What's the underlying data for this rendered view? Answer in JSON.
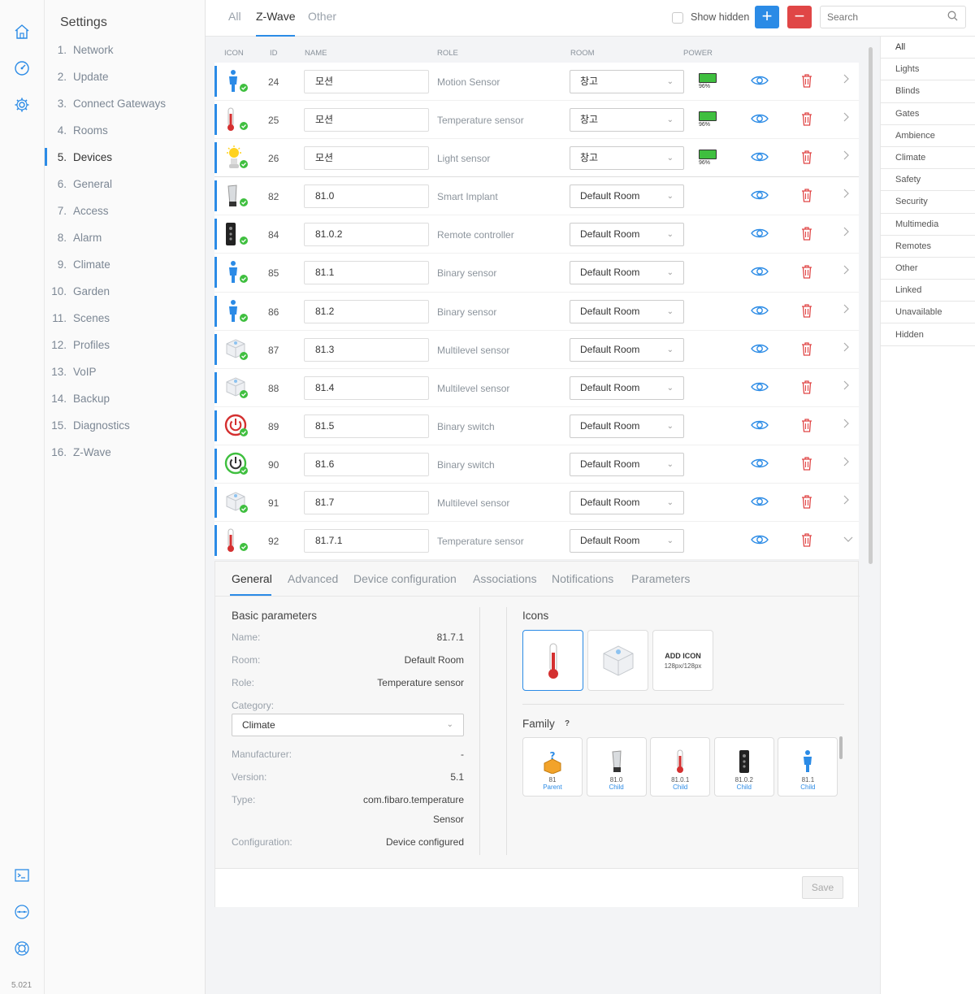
{
  "version": "5.021",
  "settings": {
    "title": "Settings",
    "items": [
      {
        "num": "1.",
        "label": "Network"
      },
      {
        "num": "2.",
        "label": "Update"
      },
      {
        "num": "3.",
        "label": "Connect Gateways"
      },
      {
        "num": "4.",
        "label": "Rooms"
      },
      {
        "num": "5.",
        "label": "Devices"
      },
      {
        "num": "6.",
        "label": "General"
      },
      {
        "num": "7.",
        "label": "Access"
      },
      {
        "num": "8.",
        "label": "Alarm"
      },
      {
        "num": "9.",
        "label": "Climate"
      },
      {
        "num": "10.",
        "label": "Garden"
      },
      {
        "num": "11.",
        "label": "Scenes"
      },
      {
        "num": "12.",
        "label": "Profiles"
      },
      {
        "num": "13.",
        "label": "VoIP"
      },
      {
        "num": "14.",
        "label": "Backup"
      },
      {
        "num": "15.",
        "label": "Diagnostics"
      },
      {
        "num": "16.",
        "label": "Z-Wave"
      }
    ]
  },
  "topbar": {
    "tabs": [
      "All",
      "Z-Wave",
      "Other"
    ],
    "show_hidden": "Show hidden",
    "add": "+",
    "remove": "−",
    "search_placeholder": "Search"
  },
  "filters": [
    "All",
    "Lights",
    "Blinds",
    "Gates",
    "Ambience",
    "Climate",
    "Safety",
    "Security",
    "Multimedia",
    "Remotes",
    "Other",
    "Linked",
    "Unavailable",
    "Hidden"
  ],
  "table": {
    "headers": {
      "icon": "ICON",
      "id": "ID",
      "name": "NAME",
      "role": "ROLE",
      "room": "ROOM",
      "power": "POWER"
    },
    "rows": [
      {
        "id": "24",
        "name": "모션",
        "role": "Motion Sensor",
        "room": "창고",
        "power": "96%",
        "icon": "person-icon"
      },
      {
        "id": "25",
        "name": "모션",
        "role": "Temperature sensor",
        "room": "창고",
        "power": "96%",
        "icon": "thermometer-icon"
      },
      {
        "id": "26",
        "name": "모션",
        "role": "Light sensor",
        "room": "창고",
        "power": "96%",
        "icon": "bulb-icon"
      },
      {
        "id": "82",
        "name": "81.0",
        "role": "Smart Implant",
        "room": "Default Room",
        "power": "",
        "icon": "implant-icon"
      },
      {
        "id": "84",
        "name": "81.0.2",
        "role": "Remote controller",
        "room": "Default Room",
        "power": "",
        "icon": "remote-icon"
      },
      {
        "id": "85",
        "name": "81.1",
        "role": "Binary sensor",
        "room": "Default Room",
        "power": "",
        "icon": "person-icon"
      },
      {
        "id": "86",
        "name": "81.2",
        "role": "Binary sensor",
        "room": "Default Room",
        "power": "",
        "icon": "person-icon"
      },
      {
        "id": "87",
        "name": "81.3",
        "role": "Multilevel sensor",
        "room": "Default Room",
        "power": "",
        "icon": "cube-icon"
      },
      {
        "id": "88",
        "name": "81.4",
        "role": "Multilevel sensor",
        "room": "Default Room",
        "power": "",
        "icon": "cube-icon"
      },
      {
        "id": "89",
        "name": "81.5",
        "role": "Binary switch",
        "room": "Default Room",
        "power": "",
        "icon": "power-red-icon"
      },
      {
        "id": "90",
        "name": "81.6",
        "role": "Binary switch",
        "room": "Default Room",
        "power": "",
        "icon": "power-green-icon"
      },
      {
        "id": "91",
        "name": "81.7",
        "role": "Multilevel sensor",
        "room": "Default Room",
        "power": "",
        "icon": "cube-icon"
      },
      {
        "id": "92",
        "name": "81.7.1",
        "role": "Temperature sensor",
        "room": "Default Room",
        "power": "",
        "icon": "thermometer-icon"
      }
    ]
  },
  "detail": {
    "tabs": [
      "General",
      "Advanced",
      "Device configuration",
      "Associations",
      "Notifications",
      "Parameters"
    ],
    "basic": {
      "title": "Basic parameters",
      "name_label": "Name:",
      "name": "81.7.1",
      "room_label": "Room:",
      "room": "Default Room",
      "role_label": "Role:",
      "role": "Temperature sensor",
      "category_label": "Category:",
      "category": "Climate",
      "manufacturer_label": "Manufacturer:",
      "manufacturer": "-",
      "version_label": "Version:",
      "version": "5.1",
      "type_label": "Type:",
      "type_line1": "com.fibaro.temperature",
      "type_line2": "Sensor",
      "configuration_label": "Configuration:",
      "configuration": "Device configured"
    },
    "icons": {
      "title": "Icons",
      "add_title": "ADD ICON",
      "add_size": "128px/128px"
    },
    "family": {
      "title": "Family",
      "help": "?",
      "members": [
        {
          "id": "81",
          "relation": "Parent",
          "icon": "parent-cube-icon"
        },
        {
          "id": "81.0",
          "relation": "Child",
          "icon": "implant-icon"
        },
        {
          "id": "81.0.1",
          "relation": "Child",
          "icon": "thermometer-icon"
        },
        {
          "id": "81.0.2",
          "relation": "Child",
          "icon": "remote-icon"
        },
        {
          "id": "81.1",
          "relation": "Child",
          "icon": "person-icon"
        }
      ]
    },
    "save": "Save"
  },
  "colors": {
    "accent": "#2b8be6",
    "danger": "#e04646",
    "ok": "#3fbf3f"
  }
}
